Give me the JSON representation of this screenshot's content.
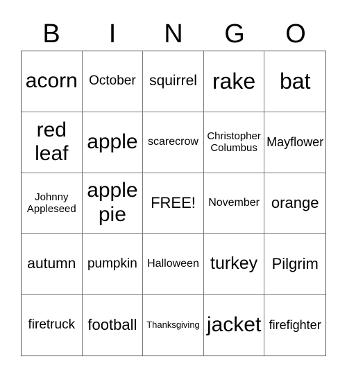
{
  "header": [
    "B",
    "I",
    "N",
    "G",
    "O"
  ],
  "rows": [
    [
      "acorn",
      "October",
      "squirrel",
      "rake",
      "bat"
    ],
    [
      "red leaf",
      "apple",
      "scarecrow",
      "Christopher Columbus",
      "Mayflower"
    ],
    [
      "Johnny Appleseed",
      "apple pie",
      "FREE!",
      "November",
      "orange"
    ],
    [
      "autumn",
      "pumpkin",
      "Halloween",
      "turkey",
      "Pilgrim"
    ],
    [
      "firetruck",
      "football",
      "Thanksgiving",
      "jacket",
      "firefighter"
    ]
  ]
}
